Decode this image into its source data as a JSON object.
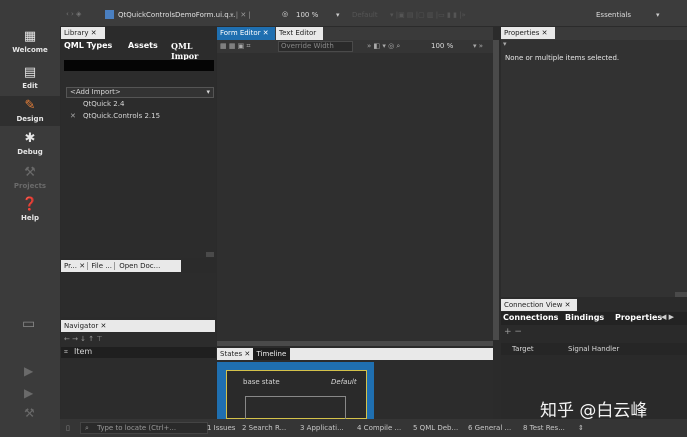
{
  "modes": [
    "Welcome",
    "Edit",
    "Design",
    "Debug",
    "Projects",
    "Help"
  ],
  "topbar": {
    "filename": "QtQuickControlsDemoForm.ui.q...",
    "zoom": "100 %",
    "state": "Default",
    "workspace": "Essentials"
  },
  "library": {
    "title": "Library",
    "tabs": [
      "QML Types",
      "Assets",
      "QML Impor"
    ],
    "add_import": "<Add Import>",
    "imports": [
      "QtQuick 2.4",
      "QtQuick.Controls 2.15"
    ]
  },
  "left_bottom_tabs": [
    "Pr...",
    "File ...",
    "Open Doc..."
  ],
  "navigator": {
    "title": "Navigator",
    "item": "Item"
  },
  "editor": {
    "tabs": [
      "Form Editor",
      "Text Editor"
    ],
    "override_width": "Override Width",
    "zoom": "100 %"
  },
  "states": {
    "tabs": [
      "States",
      "Timeline"
    ],
    "base_state": "base state",
    "default_label": "Default"
  },
  "properties": {
    "title": "Properties",
    "message": "None or multiple items selected."
  },
  "connection_view": {
    "title": "Connection View",
    "tabs": [
      "Connections",
      "Bindings",
      "Properties"
    ],
    "columns": [
      "Target",
      "Signal Handler"
    ]
  },
  "statusbar": {
    "locate_placeholder": "Type to locate (Ctrl+...",
    "items": [
      "1 Issues",
      "2 Search R...",
      "3 Applicati...",
      "4 Compile ...",
      "5 QML Deb...",
      "6 General ...",
      "8 Test Res..."
    ]
  },
  "watermark": "知乎 @白云峰"
}
